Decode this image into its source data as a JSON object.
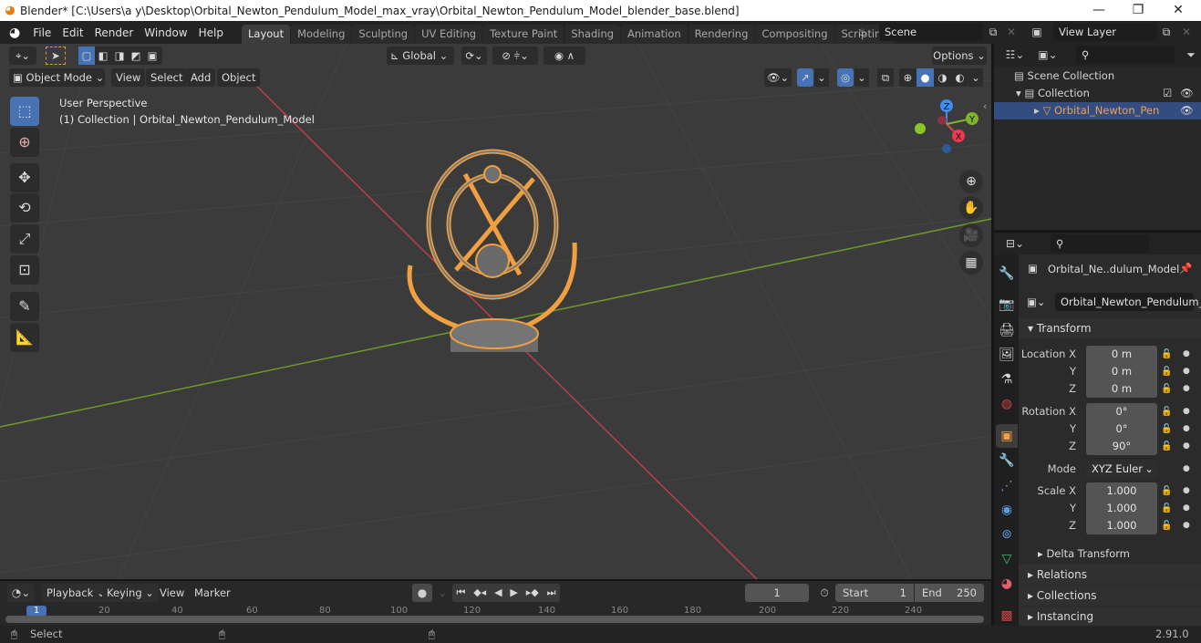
{
  "window": {
    "title": "Blender* [C:\\Users\\a y\\Desktop\\Orbital_Newton_Pendulum_Model_max_vray\\Orbital_Newton_Pendulum_Model_blender_base.blend]",
    "minimize": "—",
    "maximize": "❐",
    "close": "✕"
  },
  "menubar": {
    "items": [
      "File",
      "Edit",
      "Render",
      "Window",
      "Help"
    ],
    "workspaces": [
      "Layout",
      "Modeling",
      "Sculpting",
      "UV Editing",
      "Texture Paint",
      "Shading",
      "Animation",
      "Rendering",
      "Compositing",
      "Scripting"
    ],
    "active_workspace": "Layout",
    "add_workspace": "+",
    "scene_label": "Scene",
    "view_layer_label": "View Layer"
  },
  "viewport_header": {
    "transform_orientation": "Global",
    "options_label": "Options",
    "mode": "Object Mode",
    "menus": [
      "View",
      "Select",
      "Add",
      "Object"
    ]
  },
  "viewport": {
    "perspective_label": "User Perspective",
    "collection_label": "(1) Collection | Orbital_Newton_Pendulum_Model",
    "gizmo": {
      "x": "X",
      "y": "Y",
      "z": "Z"
    },
    "colors": {
      "x_axis": "#b8404a",
      "y_axis": "#6e9a2a",
      "selection": "#f0a040",
      "active_tool": "#4772b3"
    }
  },
  "tools": [
    "select-box",
    "cursor",
    "move",
    "rotate",
    "scale",
    "transform",
    "annotate",
    "measure"
  ],
  "outliner": {
    "search_placeholder": "",
    "rows": [
      {
        "label": "Scene Collection",
        "level": 0
      },
      {
        "label": "Collection",
        "level": 1
      },
      {
        "label": "Orbital_Newton_Pen",
        "level": 2,
        "selected": true
      }
    ]
  },
  "properties": {
    "search_placeholder": "",
    "object_name": "Orbital_Ne..dulum_Model",
    "datablock_name": "Orbital_Newton_Pendulum_...",
    "transform_title": "Transform",
    "location": {
      "label": "Location X",
      "x": "0 m",
      "y": "0 m",
      "z": "0 m"
    },
    "rotation": {
      "label": "Rotation X",
      "x": "0°",
      "y": "0°",
      "z": "90°"
    },
    "mode_label": "Mode",
    "mode_value": "XYZ Euler",
    "scale": {
      "label": "Scale X",
      "x": "1.000",
      "y": "1.000",
      "z": "1.000"
    },
    "axis_y": "Y",
    "axis_z": "Z",
    "subpanels": [
      "Delta Transform"
    ],
    "panels": [
      "Relations",
      "Collections",
      "Instancing"
    ]
  },
  "timeline": {
    "menus": [
      "Playback",
      "Keying",
      "View",
      "Marker"
    ],
    "current_frame": "1",
    "start_label": "Start",
    "start_value": "1",
    "end_label": "End",
    "end_value": "250",
    "ruler": [
      "1",
      "20",
      "40",
      "60",
      "80",
      "100",
      "120",
      "140",
      "160",
      "180",
      "200",
      "220",
      "240"
    ]
  },
  "statusbar": {
    "select_label": "Select",
    "version": "2.91.0"
  }
}
